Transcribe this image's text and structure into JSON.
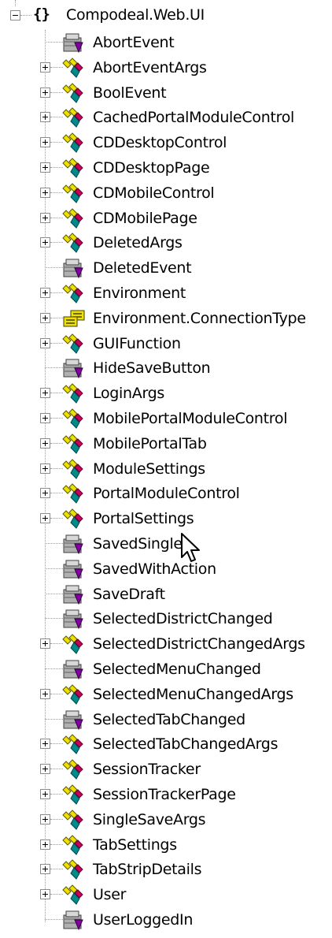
{
  "namespace": {
    "icon": "namespace-braces-icon",
    "icon_glyph": "{}",
    "label": "Compodeal.Web.UI",
    "expanded": true
  },
  "items": [
    {
      "label": "AbortEvent",
      "kind": "delegate",
      "expandable": false
    },
    {
      "label": "AbortEventArgs",
      "kind": "class",
      "expandable": true
    },
    {
      "label": "BoolEvent",
      "kind": "class",
      "expandable": true
    },
    {
      "label": "CachedPortalModuleControl",
      "kind": "class",
      "expandable": true
    },
    {
      "label": "CDDesktopControl",
      "kind": "class",
      "expandable": true
    },
    {
      "label": "CDDesktopPage",
      "kind": "class",
      "expandable": true
    },
    {
      "label": "CDMobileControl",
      "kind": "class",
      "expandable": true
    },
    {
      "label": "CDMobilePage",
      "kind": "class",
      "expandable": true
    },
    {
      "label": "DeletedArgs",
      "kind": "class",
      "expandable": true
    },
    {
      "label": "DeletedEvent",
      "kind": "delegate",
      "expandable": false
    },
    {
      "label": "Environment",
      "kind": "class",
      "expandable": true
    },
    {
      "label": "Environment.ConnectionType",
      "kind": "enum",
      "expandable": true
    },
    {
      "label": "GUIFunction",
      "kind": "class",
      "expandable": true
    },
    {
      "label": "HideSaveButton",
      "kind": "delegate",
      "expandable": false
    },
    {
      "label": "LoginArgs",
      "kind": "class",
      "expandable": true
    },
    {
      "label": "MobilePortalModuleControl",
      "kind": "class",
      "expandable": true
    },
    {
      "label": "MobilePortalTab",
      "kind": "class",
      "expandable": true
    },
    {
      "label": "ModuleSettings",
      "kind": "class",
      "expandable": true
    },
    {
      "label": "PortalModuleControl",
      "kind": "class",
      "expandable": true
    },
    {
      "label": "PortalSettings",
      "kind": "class",
      "expandable": true
    },
    {
      "label": "SavedSingle",
      "kind": "delegate",
      "expandable": false
    },
    {
      "label": "SavedWithAction",
      "kind": "delegate",
      "expandable": false
    },
    {
      "label": "SaveDraft",
      "kind": "delegate",
      "expandable": false
    },
    {
      "label": "SelectedDistrictChanged",
      "kind": "delegate",
      "expandable": false
    },
    {
      "label": "SelectedDistrictChangedArgs",
      "kind": "class",
      "expandable": true
    },
    {
      "label": "SelectedMenuChanged",
      "kind": "delegate",
      "expandable": false
    },
    {
      "label": "SelectedMenuChangedArgs",
      "kind": "class",
      "expandable": true
    },
    {
      "label": "SelectedTabChanged",
      "kind": "delegate",
      "expandable": false
    },
    {
      "label": "SelectedTabChangedArgs",
      "kind": "class",
      "expandable": true
    },
    {
      "label": "SessionTracker",
      "kind": "class",
      "expandable": true
    },
    {
      "label": "SessionTrackerPage",
      "kind": "class",
      "expandable": true
    },
    {
      "label": "SingleSaveArgs",
      "kind": "class",
      "expandable": true
    },
    {
      "label": "TabSettings",
      "kind": "class",
      "expandable": true
    },
    {
      "label": "TabStripDetails",
      "kind": "class",
      "expandable": true
    },
    {
      "label": "User",
      "kind": "class",
      "expandable": true
    },
    {
      "label": "UserLoggedIn",
      "kind": "delegate",
      "expandable": false
    }
  ],
  "icons": {
    "class": "class-icon",
    "delegate": "delegate-icon",
    "enum": "enum-icon",
    "expander": "expand-plus-icon",
    "collapser": "collapse-minus-icon"
  },
  "colors": {
    "class_yellow": "#f0e000",
    "class_teal": "#008a8a",
    "class_magenta": "#c8005a",
    "delegate_gray": "#b0b0b0",
    "delegate_purple": "#8000a0",
    "tree_line": "#9a9a9a"
  }
}
